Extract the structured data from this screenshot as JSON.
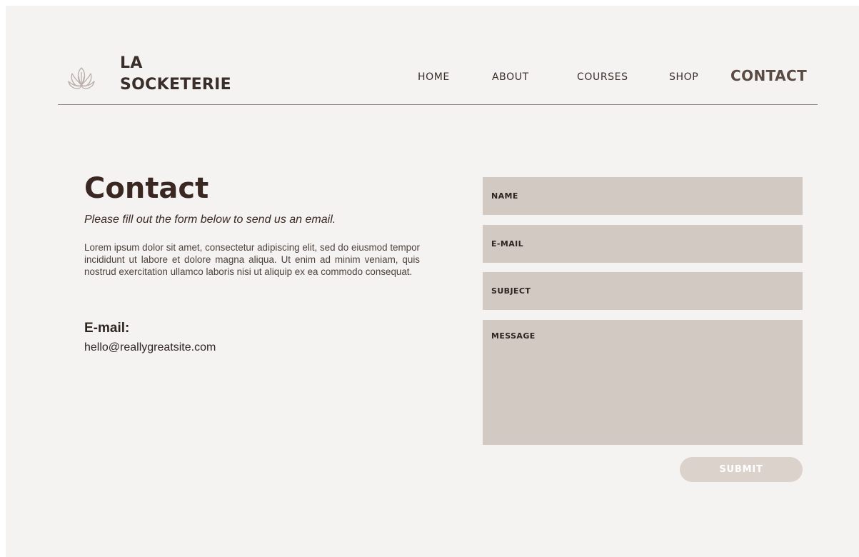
{
  "header": {
    "logo_icon": "lotus-icon",
    "brand_line1": "LA",
    "brand_line2": "SOCKETERIE"
  },
  "nav": {
    "items": [
      {
        "label": "HOME"
      },
      {
        "label": "ABOUT"
      },
      {
        "label": "COURSES"
      },
      {
        "label": "SHOP"
      },
      {
        "label": "CONTACT"
      }
    ],
    "active": "CONTACT"
  },
  "contact": {
    "title": "Contact",
    "subtitle": "Please fill out the form below to send us an email.",
    "body": "Lorem ipsum dolor sit amet, consectetur adipiscing elit, sed do eiusmod tempor incididunt ut labore et dolore magna aliqua. Ut enim ad minim veniam, quis nostrud exercitation ullamco laboris nisi ut aliquip ex ea commodo consequat.",
    "email_heading": "E-mail:",
    "email_value": "hello@reallygreatsite.com"
  },
  "form": {
    "name_placeholder": "NAME",
    "email_placeholder": "E-MAIL",
    "subject_placeholder": "SUBJECT",
    "message_placeholder": "MESSAGE",
    "submit_label": "SUBMIT"
  },
  "colors": {
    "background": "#f5f3f1",
    "field": "#d3c9c3",
    "button": "#dcd2cc",
    "text_dark": "#3a2722"
  }
}
